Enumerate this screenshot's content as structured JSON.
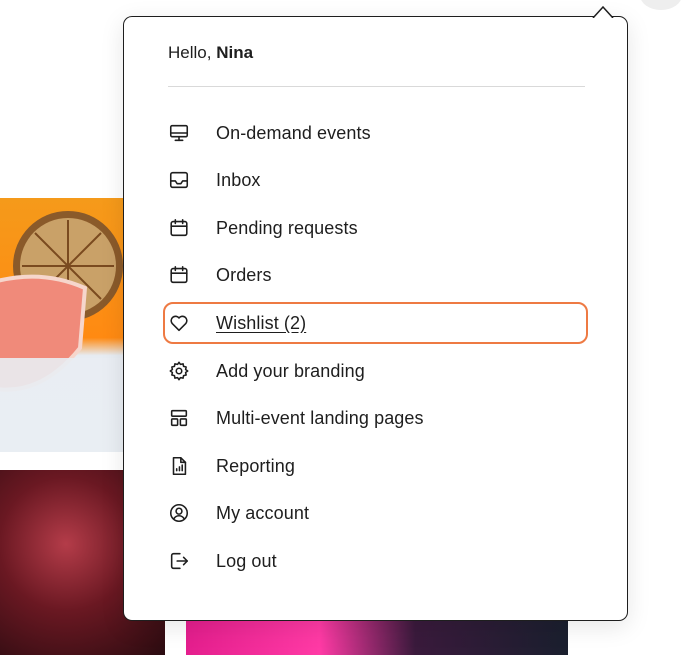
{
  "greeting": {
    "prefix": "Hello,",
    "name": "Nina"
  },
  "menu": [
    {
      "label": "On-demand events",
      "icon": "monitor-icon"
    },
    {
      "label": "Inbox",
      "icon": "inbox-icon"
    },
    {
      "label": "Pending requests",
      "icon": "calendar-icon"
    },
    {
      "label": "Orders",
      "icon": "calendar-icon"
    },
    {
      "label": "Wishlist (2)",
      "icon": "heart-icon",
      "highlighted": true
    },
    {
      "label": "Add your branding",
      "icon": "gear-icon"
    },
    {
      "label": "Multi-event landing pages",
      "icon": "layout-icon"
    },
    {
      "label": "Reporting",
      "icon": "report-file-icon"
    },
    {
      "label": "My account",
      "icon": "user-circle-icon"
    },
    {
      "label": "Log out",
      "icon": "logout-icon"
    }
  ],
  "colors": {
    "highlight": "#ee7a43",
    "text": "#1e1e1e"
  }
}
